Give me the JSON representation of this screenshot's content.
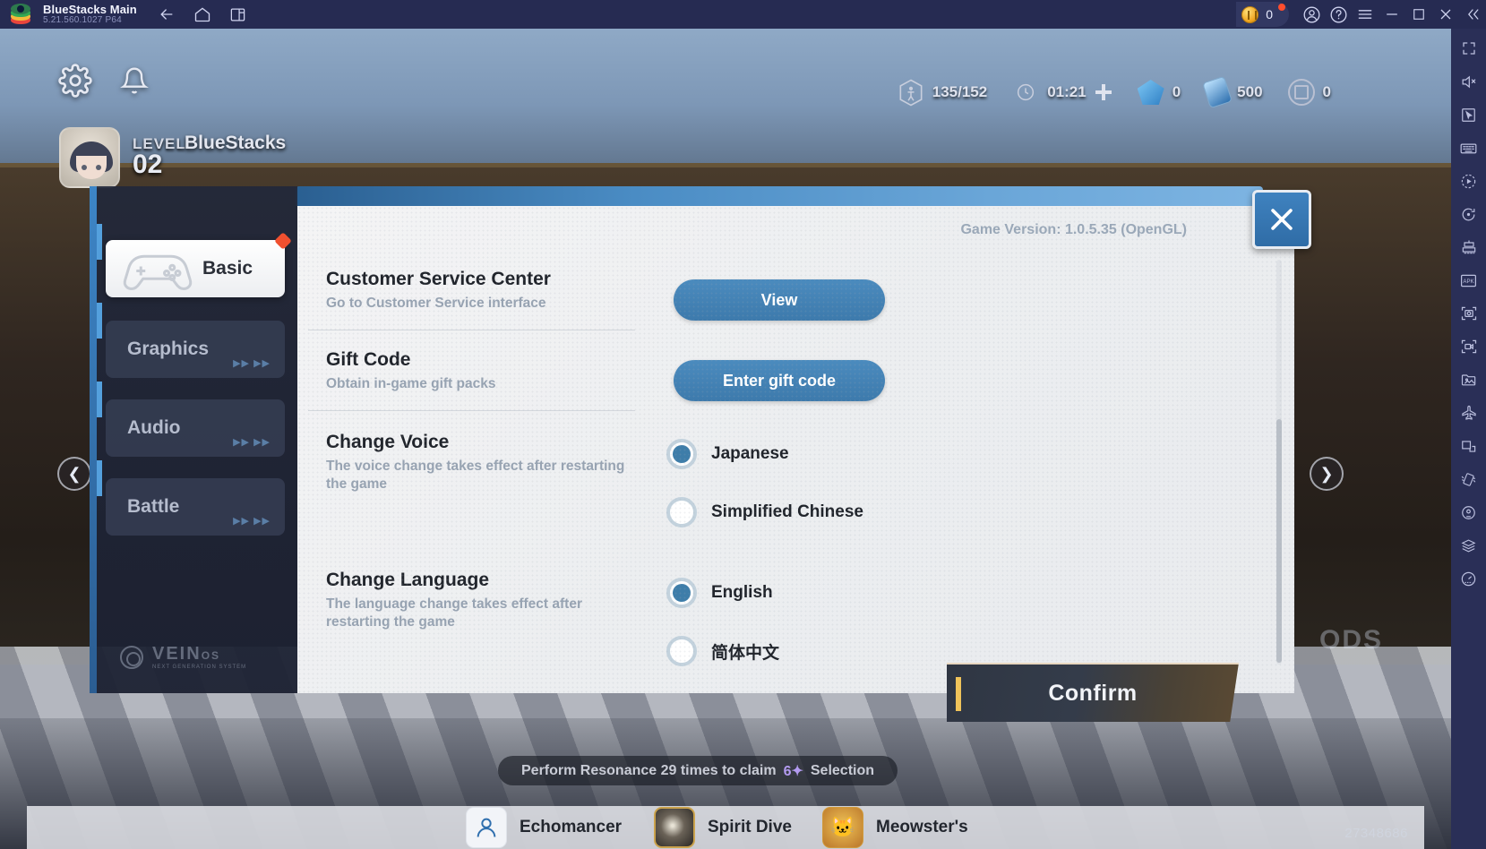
{
  "titlebar": {
    "app_title": "BlueStacks Main",
    "app_version": "5.21.560.1027  P64",
    "icons": [
      "back-icon",
      "home-icon",
      "multi-instance-icon"
    ],
    "coin_count": "0",
    "right_icons": [
      "account-icon",
      "help-icon",
      "menu-icon",
      "minimize-icon",
      "maximize-icon",
      "close-icon",
      "collapse-icon"
    ]
  },
  "rail": {
    "items": [
      "fullscreen-icon",
      "mute-icon",
      "cursor-icon",
      "keymapping-icon",
      "macro-icon",
      "sync-icon",
      "multi-instance-manager-icon",
      "install-apk-icon",
      "screenshot-icon",
      "record-icon",
      "media-manager-icon",
      "airplane-mode-icon",
      "pip-icon",
      "shake-icon",
      "location-icon",
      "layers-icon",
      "performance-icon"
    ]
  },
  "game_hud": {
    "gear_icon": "settings-gear-icon",
    "bell_icon": "notifications-bell-icon",
    "player": {
      "level_label": "LEVEL",
      "level_value": "02",
      "player_name": "BlueStacks",
      "avatar": "player-avatar"
    },
    "resources": [
      {
        "icon": "stamina-icon",
        "value": "135/152"
      },
      {
        "icon": "clock-icon",
        "value": "01:21"
      },
      {
        "icon": "add-icon",
        "value": ""
      },
      {
        "icon": "gem-icon",
        "value": "0"
      },
      {
        "icon": "potion-icon",
        "value": "500"
      },
      {
        "icon": "token-icon",
        "value": "0"
      }
    ],
    "arrow_left": "prev-arrow-icon",
    "arrow_right": "next-arrow-icon",
    "quest_text_before": "Perform Resonance 29 times to claim",
    "quest_star": "6✦",
    "quest_text_after": "Selection",
    "bottom_nav": [
      {
        "label": "Echomancer",
        "icon": "echomancer-icon"
      },
      {
        "label": "Spirit Dive",
        "icon": "spirit-dive-icon"
      },
      {
        "label": "Meowster's",
        "icon": "meowster-icon"
      }
    ],
    "bottom_number": "27348686",
    "watermark": "ODS"
  },
  "dialog": {
    "game_version": "Game Version: 1.0.5.35 (OpenGL)",
    "close_icon": "close-dialog-icon",
    "tabs": [
      {
        "label": "Basic",
        "icon": "gamepad-icon",
        "active": true,
        "badge": true,
        "chevrons": ""
      },
      {
        "label": "Graphics",
        "icon": "graphics-icon",
        "active": false,
        "chevrons": "▶▶ ▶▶"
      },
      {
        "label": "Audio",
        "icon": "audio-icon",
        "active": false,
        "chevrons": "▶▶ ▶▶"
      },
      {
        "label": "Battle",
        "icon": "battle-icon",
        "active": false,
        "chevrons": "▶▶ ▶▶"
      }
    ],
    "brand": {
      "name": "VEIN",
      "suffix": "OS",
      "tagline": "NEXT GENERATION SYSTEM"
    },
    "settings": [
      {
        "title": "Customer Service Center",
        "desc": "Go to Customer Service interface",
        "control": "button",
        "button_label": "View"
      },
      {
        "title": "Gift Code",
        "desc": "Obtain in-game gift packs",
        "control": "button",
        "button_label": "Enter gift code"
      },
      {
        "title": "Change Voice",
        "desc": "The voice change takes effect after restarting the game",
        "control": "radio",
        "options": [
          {
            "label": "Japanese",
            "selected": true
          },
          {
            "label": "Simplified Chinese",
            "selected": false
          }
        ]
      },
      {
        "title": "Change Language",
        "desc": "The language change takes effect after restarting the game",
        "control": "radio",
        "options": [
          {
            "label": "English",
            "selected": true
          },
          {
            "label": "简体中文",
            "selected": false
          }
        ]
      }
    ],
    "confirm_label": "Confirm"
  },
  "colors": {
    "accent_blue": "#3e7da9",
    "button_blue": "#4b8bbe",
    "titlebar": "#262b52",
    "rail": "#2a2f57",
    "badge_red": "#f0502f",
    "confirm_gold": "#f0c35a"
  }
}
